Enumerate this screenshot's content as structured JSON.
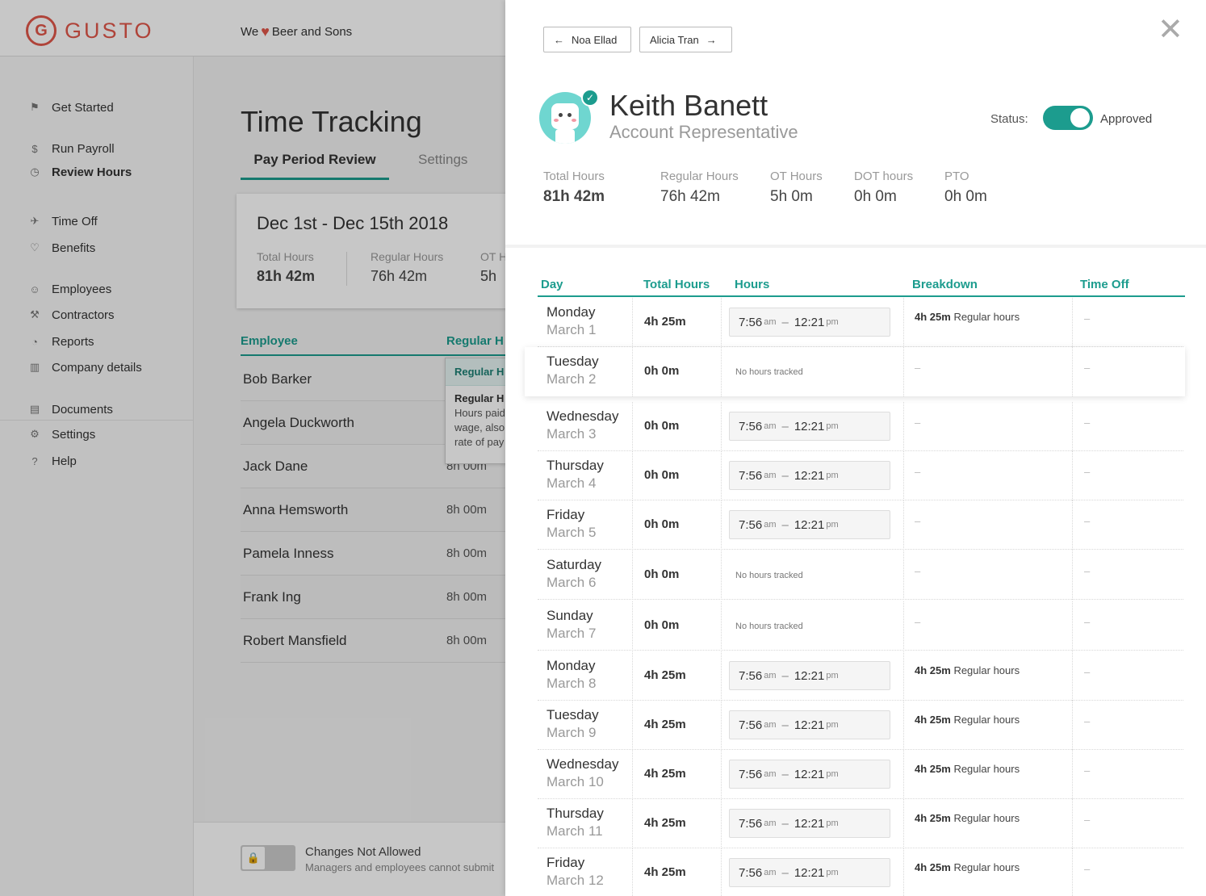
{
  "app": {
    "logo_mark": "G",
    "logo_text": "GUSTO",
    "company_prefix": "We",
    "company_name": "Beer and Sons"
  },
  "sidebar": {
    "items": [
      {
        "label": "Get Started",
        "icon": "flag-icon"
      },
      {
        "label": "Run Payroll",
        "icon": "money-bag-icon"
      },
      {
        "label": "Review Hours",
        "icon": "clock-icon"
      },
      {
        "label": "Time Off",
        "icon": "plane-icon"
      },
      {
        "label": "Benefits",
        "icon": "heart-icon"
      },
      {
        "label": "Employees",
        "icon": "person-icon"
      },
      {
        "label": "Contractors",
        "icon": "hammer-icon"
      },
      {
        "label": "Reports",
        "icon": "chart-icon"
      },
      {
        "label": "Company details",
        "icon": "building-icon"
      },
      {
        "label": "Documents",
        "icon": "document-icon"
      },
      {
        "label": "Settings",
        "icon": "gear-icon"
      },
      {
        "label": "Help",
        "icon": "question-icon"
      }
    ]
  },
  "main": {
    "title": "Time Tracking",
    "tabs": [
      "Pay Period Review",
      "Settings"
    ],
    "period_title": "Dec 1st - Dec 15th 2018",
    "stats": [
      {
        "label": "Total Hours",
        "value": "81h 42m"
      },
      {
        "label": "Regular Hours",
        "value": "76h 42m"
      },
      {
        "label": "OT H",
        "value": "5h"
      }
    ],
    "table_headers": [
      "Employee",
      "Regular H"
    ],
    "employees": [
      {
        "name": "Bob Barker",
        "hours": ""
      },
      {
        "name": "Angela Duckworth",
        "hours": ""
      },
      {
        "name": "Jack Dane",
        "hours": "8h 00m"
      },
      {
        "name": "Anna Hemsworth",
        "hours": "8h 00m"
      },
      {
        "name": "Pamela Inness",
        "hours": "8h 00m"
      },
      {
        "name": "Frank Ing",
        "hours": "8h 00m"
      },
      {
        "name": "Robert Mansfield",
        "hours": "8h 00m"
      }
    ],
    "tooltip": {
      "header": "Regular H",
      "title": "Regular H",
      "lines": [
        "Hours paid",
        "wage, also",
        "rate of pay"
      ]
    },
    "footer": {
      "title": "Changes Not Allowed",
      "subtitle": "Managers and employees cannot submit"
    }
  },
  "panel": {
    "prev_employee": "Noa Ellad",
    "next_employee": "Alicia Tran",
    "close_icon": "close-icon",
    "name": "Keith Banett",
    "role": "Account Representative",
    "status_label": "Status:",
    "status_value": "Approved",
    "status_on": true,
    "stats": [
      {
        "label": "Total Hours",
        "value": "81h 42m"
      },
      {
        "label": "Regular Hours",
        "value": "76h 42m"
      },
      {
        "label": "OT Hours",
        "value": "5h 0m"
      },
      {
        "label": "DOT hours",
        "value": "0h 0m"
      },
      {
        "label": "PTO",
        "value": "0h 0m"
      }
    ],
    "columns": [
      "Day",
      "Total Hours",
      "Hours",
      "Breakdown",
      "Time Off"
    ],
    "rows": [
      {
        "day": "Monday",
        "date": "March 1",
        "total": "4h 25m",
        "start": "7:56",
        "start_ap": "am",
        "end": "12:21",
        "end_ap": "pm",
        "breakdown_value": "4h 25m",
        "breakdown_label": "Regular hours",
        "time_off": "–"
      },
      {
        "day": "Tuesday",
        "date": "March 2",
        "total": "0h 0m",
        "no_hours": "No hours tracked",
        "breakdown_dash": "–",
        "time_off": "–",
        "highlight": true
      },
      {
        "day": "Wednesday",
        "date": "March 3",
        "total": "0h 0m",
        "start": "7:56",
        "start_ap": "am",
        "end": "12:21",
        "end_ap": "pm",
        "breakdown_dash": "–",
        "time_off": "–"
      },
      {
        "day": "Thursday",
        "date": "March 4",
        "total": "0h 0m",
        "start": "7:56",
        "start_ap": "am",
        "end": "12:21",
        "end_ap": "pm",
        "breakdown_dash": "–",
        "time_off": "–"
      },
      {
        "day": "Friday",
        "date": "March 5",
        "total": "0h 0m",
        "start": "7:56",
        "start_ap": "am",
        "end": "12:21",
        "end_ap": "pm",
        "breakdown_dash": "–",
        "time_off": "–"
      },
      {
        "day": "Saturday",
        "date": "March 6",
        "total": "0h 0m",
        "no_hours": "No hours tracked",
        "breakdown_dash": "–",
        "time_off": "–"
      },
      {
        "day": "Sunday",
        "date": "March 7",
        "total": "0h 0m",
        "no_hours": "No hours tracked",
        "breakdown_dash": "–",
        "time_off": "–"
      },
      {
        "day": "Monday",
        "date": "March 8",
        "total": "4h 25m",
        "start": "7:56",
        "start_ap": "am",
        "end": "12:21",
        "end_ap": "pm",
        "breakdown_value": "4h 25m",
        "breakdown_label": "Regular hours",
        "time_off": "–"
      },
      {
        "day": "Tuesday",
        "date": "March 9",
        "total": "4h 25m",
        "start": "7:56",
        "start_ap": "am",
        "end": "12:21",
        "end_ap": "pm",
        "breakdown_value": "4h 25m",
        "breakdown_label": "Regular hours",
        "time_off": "–"
      },
      {
        "day": "Wednesday",
        "date": "March 10",
        "total": "4h 25m",
        "start": "7:56",
        "start_ap": "am",
        "end": "12:21",
        "end_ap": "pm",
        "breakdown_value": "4h 25m",
        "breakdown_label": "Regular hours",
        "time_off": "–"
      },
      {
        "day": "Thursday",
        "date": "March 11",
        "total": "4h 25m",
        "start": "7:56",
        "start_ap": "am",
        "end": "12:21",
        "end_ap": "pm",
        "breakdown_value": "4h 25m",
        "breakdown_label": "Regular hours",
        "time_off": "–"
      },
      {
        "day": "Friday",
        "date": "March 12",
        "total": "4h 25m",
        "start": "7:56",
        "start_ap": "am",
        "end": "12:21",
        "end_ap": "pm",
        "breakdown_value": "4h 25m",
        "breakdown_label": "Regular hours",
        "time_off": "–"
      }
    ]
  },
  "colors": {
    "accent": "#1c9c8e",
    "brand": "#e0574a"
  }
}
